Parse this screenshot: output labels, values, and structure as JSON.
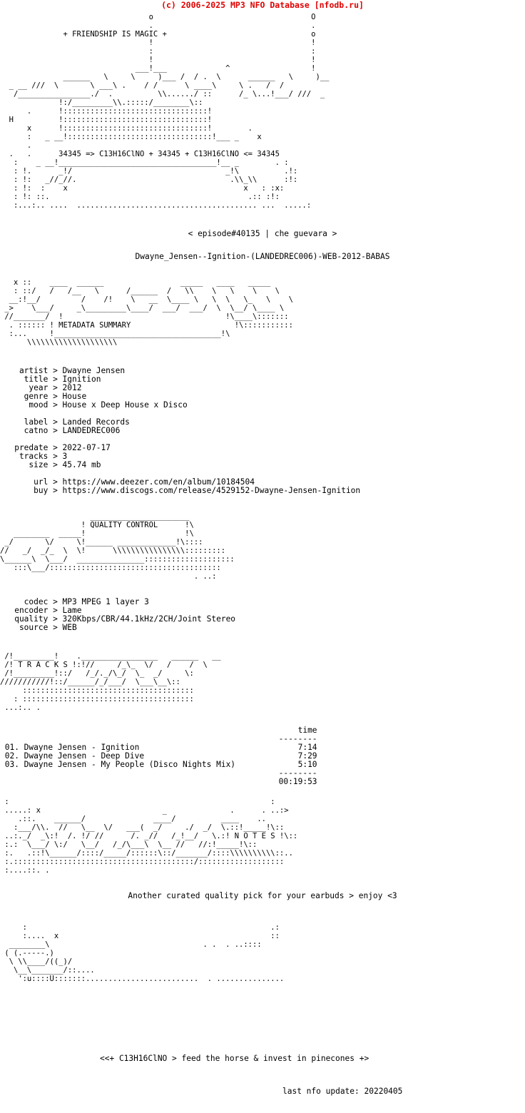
{
  "header": {
    "copyright": "(c) 2006-2025 MP3 NFO Database [nfodb.ru]",
    "color": "#e00000"
  },
  "top_art": {
    "tagline": "+ FRIENDSHIP IS MAGIC +",
    "formula_line": "34345 => C13H16ClNO + 34345 + C13H16ClNO <= 34345",
    "art_line_01": "                                 o                                   O",
    "art_line_02": "                                 .                                   .",
    "art_line_03": "              + FRIENDSHIP IS MAGIC +                                o",
    "art_line_04": "                                 !                                   !",
    "art_line_05": "                                 :                                   :",
    "art_line_06": "                                 !                                   !",
    "art_line_07": "                              ___!___             ^                  !",
    "art_line_08": "              ______   \\     \\     )___ /  / .  \\      ______   \\     )__",
    "art_line_09": "  _ __ ///  \\       \\ ___\\ .    / /      \\ ____\\     \\ .   /  /",
    "art_line_10": "   /________________./  .          \\\\....../ ::      /_ \\...!___/ ///  _",
    "art_line_11": "             !:/_________\\\\.:::::/________\\::",
    "art_line_12": "      .      !::::::::::::::::::::::::::::::::!",
    "art_line_13": "  H          !::::::::::::::::::::::::::::::::!",
    "art_line_14": "      x      !::::::::::::::::::::::::::::::::!        .",
    "art_line_15": "      :   _ __!::::::::::::::::::::::::::::::::!___ _    x",
    "art_line_16": "      .",
    "art_line_17": "  .   .      34345 => C13H16ClNO + 34345 + C13H16ClNO <= 34345",
    "art_line_18": "   :    _ __!___________________________________!__ _        . :",
    "art_line_19": "   : !.      _!/                                  _!\\          .!:",
    "art_line_20": "   : !:   _//_//.                                  .\\\\_\\\\      :!:",
    "art_line_21": "   : !:  :    x                                       x   : :x:",
    "art_line_22": "   : !: ::.                                            .:: :!:",
    "art_line_23": "   :...:.. ....  ........................................ ...  .....:"
  },
  "episode": {
    "line": "< episode#40135 | che guevara >"
  },
  "release": {
    "name": "Dwayne_Jensen--Ignition-(LANDEDREC006)-WEB-2012-BABAS"
  },
  "metadata_banner": {
    "title": "METADATA SUMMARY",
    "art_line_01": "   x ::    ____  ______                 _____   ____   _____",
    "art_line_02": "   : ::/   /   /__   \\      /______  /   \\\\    \\   \\    \\    \\",
    "art_line_03": "  __:!__/         /    /!    \\   __  \\____ \\   \\  \\   \\_   \\    \\",
    "art_line_04": " _>    \\___/     _\\_________\\____/  ___/  ___/  \\  \\__/ \\____ \\",
    "art_line_05": " //_______/  !                                    !\\____\\:::::::",
    "art_line_06": "  . :::::: ! METADATA SUMMARY                       !\\:::::::::::",
    "art_line_07": "  :...     !_____________________________________!\\",
    "art_line_08": "      \\\\\\\\\\\\\\\\\\\\\\\\\\\\\\\\\\\\\\\\"
  },
  "metadata": {
    "fields": [
      {
        "key": "artist",
        "sep": ">",
        "value": "Dwayne Jensen"
      },
      {
        "key": "title",
        "sep": ">",
        "value": "Ignition"
      },
      {
        "key": "year",
        "sep": ">",
        "value": "2012"
      },
      {
        "key": "genre",
        "sep": ">",
        "value": "House"
      },
      {
        "key": "mood",
        "sep": ">",
        "value": "House x Deep House x Disco"
      }
    ],
    "label_fields": [
      {
        "key": "label",
        "sep": ">",
        "value": "Landed Records"
      },
      {
        "key": "catno",
        "sep": ">",
        "value": "LANDEDREC006"
      }
    ],
    "release_fields": [
      {
        "key": "predate",
        "sep": ">",
        "value": "2022-07-17"
      },
      {
        "key": "tracks",
        "sep": ">",
        "value": "3"
      },
      {
        "key": "size",
        "sep": ">",
        "value": "45.74 mb"
      }
    ],
    "link_fields": [
      {
        "key": "url",
        "sep": ">",
        "value": "https://www.deezer.com/en/album/10184504"
      },
      {
        "key": "buy",
        "sep": ">",
        "value": "https://www.discogs.com/release/4529152-Dwayne-Jensen-Ignition"
      }
    ],
    "block_1": "    artist > Dwayne Jensen\n     title > Ignition\n      year > 2012\n     genre > House\n      mood > House x Deep House x Disco",
    "block_2": "     label > Landed Records\n     catno > LANDEDREC006",
    "block_3": "   predate > 2022-07-17\n    tracks > 3\n      size > 45.74 mb",
    "block_4": "       url > https://www.deezer.com/en/album/10184504\n       buy > https://www.discogs.com/release/4529152-Dwayne-Jensen-Ignition"
  },
  "quality_banner": {
    "title": "QUALITY CONTROL",
    "art_line_01": "                    ______________________",
    "art_line_02": "                  ! QUALITY CONTROL      !\\",
    "art_line_03": "   ________  _____!                      !\\",
    "art_line_04": " _/       \\/     \\!______ _____________!\\::::",
    "art_line_05": "//   _/  _/_  \\  \\!      \\\\\\\\\\\\\\\\\\\\\\\\\\\\\\\\:::::::::",
    "art_line_06": "\\______\\  \\___/  _______________::::::::::::::::::::",
    "art_line_07": "   :::\\___/::::::::::::::::::::::::::::::::::::::",
    "art_line_08": "                                           . ..:"
  },
  "quality": {
    "fields": [
      {
        "key": "codec",
        "sep": ">",
        "value": "MP3 MPEG 1 layer 3"
      },
      {
        "key": "encoder",
        "sep": ">",
        "value": "Lame"
      },
      {
        "key": "quality",
        "sep": ">",
        "value": "320Kbps/CBR/44.1kHz/2CH/Joint Stereo"
      },
      {
        "key": "source",
        "sep": ">",
        "value": "WEB"
      }
    ],
    "block": "     codec > MP3 MPEG 1 layer 3\n   encoder > Lame\n   quality > 320Kbps/CBR/44.1kHz/2CH/Joint Stereo\n    source > WEB"
  },
  "tracks_banner": {
    "title": "T R A C K S",
    "art_line_01": " /!_________!    ._________________   ______   __",
    "art_line_02": " /! T R A C K S !:!//     /_\\_  \\/   /    /  \\",
    "art_line_03": " /!_________!::/   /_/._/\\_/  \\_  _/     \\:",
    "art_line_04": "///////////!::/______/_/___/  \\___\\__\\::",
    "art_line_05": "     ::::::::::::::::::::::::::::::::::::::",
    "art_line_06": "   : ::::::::::::::::::::::::::::::::::::::",
    "art_line_07": " ...:.. ."
  },
  "tracklist": {
    "time_header": "time",
    "divider": "--------",
    "items": [
      {
        "num": "01.",
        "artist": "Dwayne Jensen",
        "dash": "-",
        "title": "Ignition",
        "time": "7:14"
      },
      {
        "num": "02.",
        "artist": "Dwayne Jensen",
        "dash": "-",
        "title": "Deep Dive",
        "time": "7:29"
      },
      {
        "num": "03.",
        "artist": "Dwayne Jensen",
        "dash": "-",
        "title": "My People (Disco Nights Mix)",
        "time": "5:10"
      }
    ],
    "total_time": "00:19:53",
    "block": "                                                              time\n                                                          --------\n 01. Dwayne Jensen - Ignition                                 7:14\n 02. Dwayne Jensen - Deep Dive                                7:29\n 03. Dwayne Jensen - My People (Disco Nights Mix)             5:10\n                                                          --------\n                                                          00:19:53"
  },
  "notes_banner": {
    "title": "N O T E S",
    "art_line_01": " :                                                          :",
    "art_line_02": " .....: x                           _              .      . ..:>",
    "art_line_03": "    .::.    ______/               ____/          ____    ..",
    "art_line_04": "   :___/\\\\.  //   \\__  \\/   ___(  _/     ./  _/  \\.::!_____!\\::",
    "art_line_05": " ..:._/  _\\:!  /. !/ //      /. _//   /_!__/   \\.:! N O T E S !\\::",
    "art_line_06": " :.:  \\___/ \\:/   \\__/   /_/\\___\\  \\__ //   //:!_____!\\::",
    "art_line_07": " :.   .::!\\______/::::/_____/::::::\\::/_______/::::\\\\\\\\\\\\\\\\\\\\::..",
    "art_line_08": " :.::::::::::::::::::::::::::::::::::::::::/:::::::::::::::::::",
    "art_line_09": " :....::. ."
  },
  "notes": {
    "text": "Another curated quality pick for your earbuds > enjoy <3"
  },
  "footer_art": {
    "line_01": "     :                                                      .:",
    "line_02": "     :....  x                                               ::",
    "line_03": "  ________\\                                  . .  . ..::::",
    "line_04": " ( (.-----.)",
    "line_05": "  \\ \\\\____/((_)/ ",
    "line_06": "   \\__\\_______/::....",
    "line_07": "    ':u::::U:::::::.........................  . ..............."
  },
  "footer": {
    "slogan": "<<+ C13H16ClNO > feed the horse & invest in pinecones +>",
    "last_update_label": "last nfo update:",
    "last_update_value": "20220405",
    "last_update_line": "last nfo update: 20220405"
  }
}
